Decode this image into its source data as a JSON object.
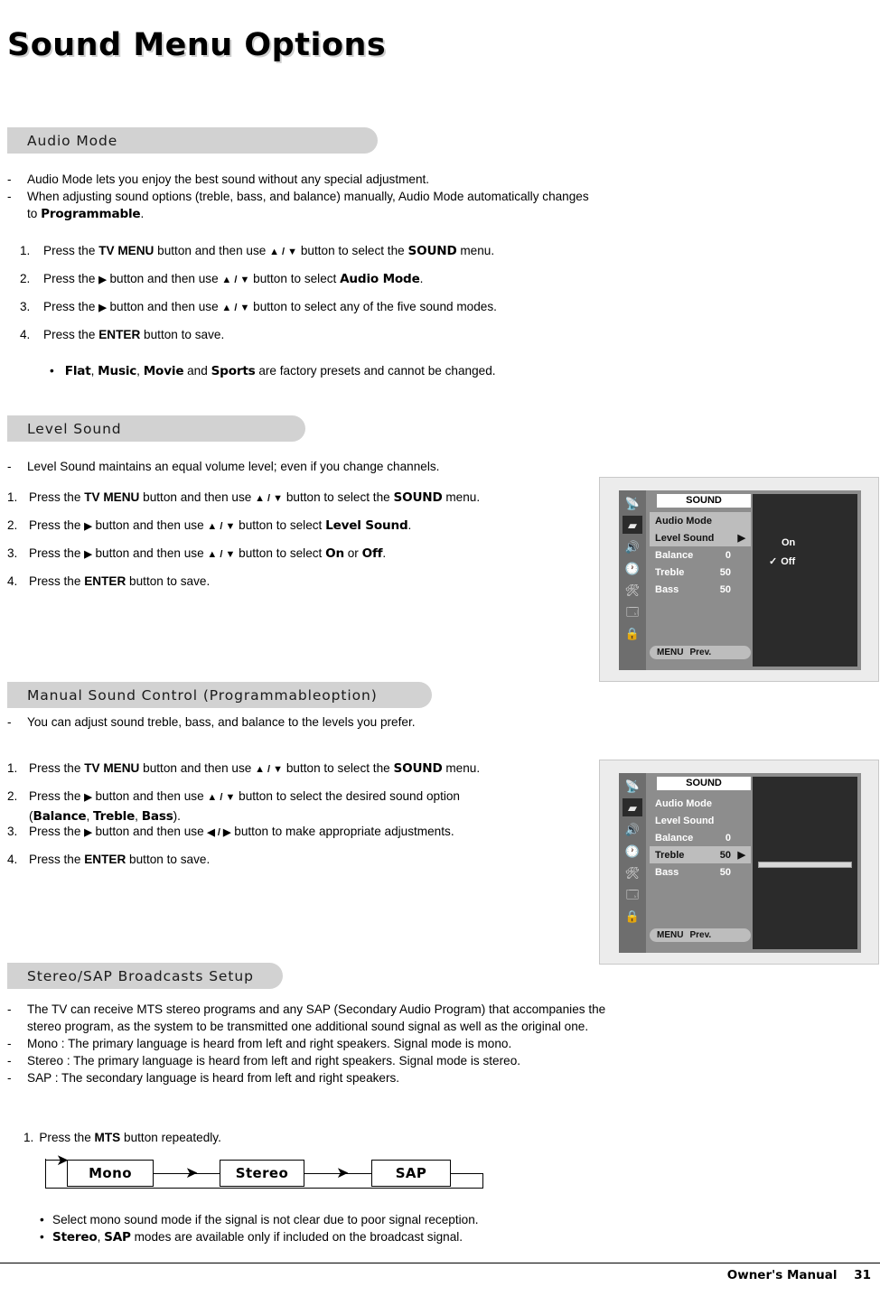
{
  "page": {
    "title": "Sound Menu Options",
    "footer_label": "Owner's Manual",
    "footer_page": "31"
  },
  "sections": {
    "audio_mode": {
      "heading": "Audio Mode",
      "bullets": [
        "Audio Mode lets you enjoy the best sound without any special adjustment.",
        "When adjusting sound options (treble, bass, and balance) manually, Audio Mode automatically changes"
      ],
      "bullet2_cont_pre": "to ",
      "bullet2_cont_bold": "Programmable",
      "bullet2_cont_post": ".",
      "steps": [
        {
          "n": "1.",
          "pre": "Press the ",
          "b1": "TV MENU",
          "mid": " button and then use ",
          "keys": "▲ / ▼",
          "mid2": " button to select the ",
          "b2": "SOUND",
          "post": " menu."
        },
        {
          "n": "2.",
          "pre": "Press the ",
          "b1": "▶",
          "mid": " button and then use ",
          "keys": "▲ / ▼",
          "mid2": " button to select ",
          "b2": "Audio Mode",
          "post": "."
        },
        {
          "n": "3.",
          "pre": "Press the ",
          "b1": "▶",
          "mid": " button and then use ",
          "keys": "▲ / ▼",
          "mid2": " button to select any of the five sound modes.",
          "b2": "",
          "post": ""
        },
        {
          "n": "4.",
          "pre": "Press the ",
          "b1": "ENTER",
          "mid": " button to save.",
          "keys": "",
          "mid2": "",
          "b2": "",
          "post": ""
        }
      ],
      "note_bullet": "•",
      "note": {
        "i1": "Flat",
        "i2": "Music",
        "i3": "Movie",
        "i4": "Sports",
        "tail": " are factory presets and cannot be changed.",
        "and": " and ",
        "comma": ", "
      }
    },
    "level_sound": {
      "heading": "Level Sound",
      "bullet": "Level Sound maintains an equal volume level; even if you change channels.",
      "steps": [
        {
          "n": "1.",
          "pre": "Press the ",
          "b1": "TV MENU",
          "mid": " button and then use ",
          "keys": "▲ / ▼",
          "mid2": " button to select the ",
          "b2": "SOUND",
          "post": " menu."
        },
        {
          "n": "2.",
          "pre": "Press the ",
          "b1": "▶",
          "mid": " button and then use ",
          "keys": "▲ / ▼",
          "mid2": " button to select ",
          "b2": "Level Sound",
          "post": "."
        },
        {
          "n": "3.",
          "pre": "Press the ",
          "b1": "▶",
          "mid": " button and then use ",
          "keys": "▲ / ▼",
          "mid2": " button to select ",
          "b2": "On",
          "post": " or ",
          "b3": "Off",
          "post2": "."
        },
        {
          "n": "4.",
          "pre": "Press the ",
          "b1": "ENTER",
          "mid": " button to save.",
          "keys": "",
          "mid2": "",
          "b2": "",
          "post": ""
        }
      ]
    },
    "manual_sound": {
      "heading_pre": "Manual Sound Control (",
      "heading_bold": "Programmable",
      "heading_post": " option)",
      "bullet": "You can adjust sound treble, bass, and balance to the levels you prefer.",
      "steps": [
        {
          "n": "1.",
          "pre": "Press the ",
          "b1": "TV MENU",
          "mid": " button and then use ",
          "keys": "▲ / ▼",
          "mid2": " button to select the ",
          "b2": "SOUND",
          "post": " menu."
        },
        {
          "n": "2.",
          "pre": "Press the ",
          "b1": "▶",
          "mid": " button and then use ",
          "keys": "▲ / ▼",
          "mid2": " button to select the desired sound option",
          "b2": "",
          "post": ""
        },
        {
          "n": "3.",
          "pre": "Press the ",
          "b1": "▶",
          "mid": " button and then use ",
          "keys": "◀ / ▶",
          "mid2": " button to make appropriate adjustments.",
          "b2": "",
          "post": ""
        },
        {
          "n": "4.",
          "pre": "Press the ",
          "b1": "ENTER",
          "mid": " button to save.",
          "keys": "",
          "mid2": "",
          "b2": "",
          "post": ""
        }
      ],
      "step2_options": {
        "open": "(",
        "o1": "Balance",
        "o2": "Treble",
        "o3": "Bass",
        "close": ").",
        "comma": ", "
      }
    },
    "stereo_sap": {
      "heading": "Stereo/SAP Broadcasts Setup",
      "bullets": [
        "The TV can receive MTS stereo programs and any SAP (Secondary Audio Program) that accompanies the",
        "Mono : The primary language is heard from left and right speakers. Signal mode is mono.",
        "Stereo : The primary language is heard from left and right speakers. Signal mode is stereo.",
        "SAP : The secondary language is heard from left and right speakers."
      ],
      "bullet1_cont": "stereo program, as the system to be transmitted one additional sound signal as well as the original one.",
      "step": {
        "n": "1.",
        "pre": "Press the ",
        "b1": "MTS",
        "post": " button repeatedly."
      },
      "flow": [
        "Mono",
        "Stereo",
        "SAP"
      ],
      "notes": [
        {
          "bullet": "•",
          "text": "Select mono sound mode if the signal is not clear due to poor signal reception."
        },
        {
          "bullet": "•",
          "b1": "Stereo",
          "comma": ", ",
          "b2": "SAP",
          "text": " modes are available only if included on the broadcast signal."
        }
      ]
    }
  },
  "osd_level_sound": {
    "title": "SOUND",
    "rows": [
      {
        "label": "Audio Mode",
        "value": "",
        "arrow": ""
      },
      {
        "label": "Level Sound",
        "value": "",
        "arrow": "▶"
      },
      {
        "label": "Balance",
        "value": "0",
        "arrow": ""
      },
      {
        "label": "Treble",
        "value": "50",
        "arrow": ""
      },
      {
        "label": "Bass",
        "value": "50",
        "arrow": ""
      }
    ],
    "options": [
      {
        "check": "",
        "label": "On"
      },
      {
        "check": "✓",
        "label": "Off"
      }
    ],
    "bottom": [
      "MENU",
      "Prev."
    ],
    "icons": [
      "antenna-icon",
      "picture-icon",
      "sound-icon",
      "time-icon",
      "setup-icon",
      "pip-icon",
      "lock-icon"
    ]
  },
  "osd_manual_sound": {
    "title": "SOUND",
    "rows": [
      {
        "label": "Audio Mode",
        "value": "",
        "arrow": ""
      },
      {
        "label": "Level Sound",
        "value": "",
        "arrow": ""
      },
      {
        "label": "Balance",
        "value": "0",
        "arrow": ""
      },
      {
        "label": "Treble",
        "value": "50",
        "arrow": "▶"
      },
      {
        "label": "Bass",
        "value": "50",
        "arrow": ""
      }
    ],
    "bottom": [
      "MENU",
      "Prev."
    ],
    "icons": [
      "antenna-icon",
      "picture-icon",
      "sound-icon",
      "time-icon",
      "setup-icon",
      "pip-icon",
      "lock-icon"
    ]
  }
}
